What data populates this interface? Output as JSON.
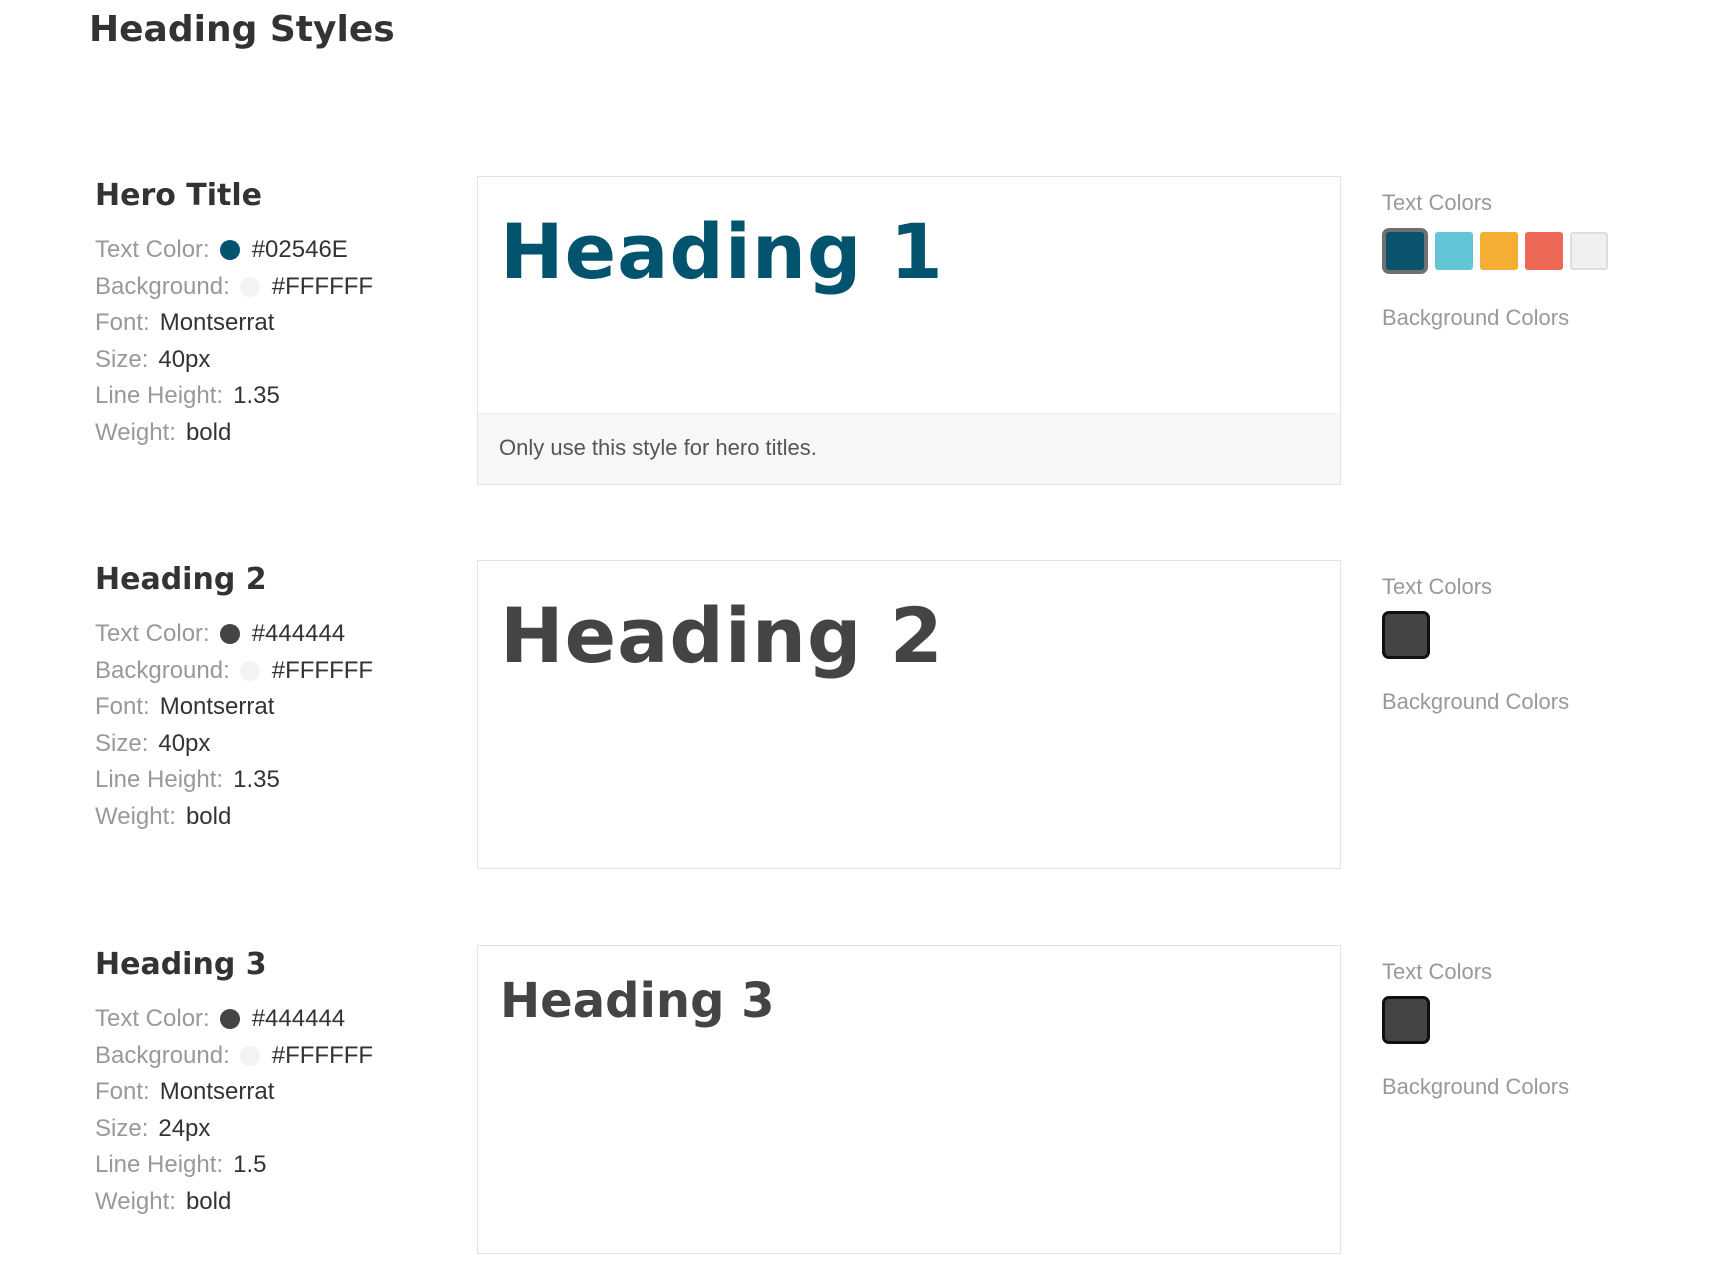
{
  "page": {
    "title": "Heading Styles"
  },
  "labels": {
    "text_color": "Text Color:",
    "background": "Background:",
    "font": "Font:",
    "size": "Size:",
    "line_height": "Line Height:",
    "weight": "Weight:",
    "text_colors": "Text Colors",
    "background_colors": "Background Colors"
  },
  "sections": [
    {
      "name": "Hero Title",
      "preview_text": "Heading 1",
      "note": "Only use this style for hero titles.",
      "text_color": "#02546E",
      "text_color_hex": "#02546E",
      "background": "#FFFFFF",
      "background_hex": "#FFFFFF",
      "font": "Montserrat",
      "size": "40px",
      "line_height": "1.35",
      "weight": "bold",
      "swatches": [
        {
          "name": "teal-swatch",
          "color": "#0B536D",
          "selected": true
        },
        {
          "name": "aqua-swatch",
          "color": "#62C6D6",
          "selected": false
        },
        {
          "name": "orange-swatch",
          "color": "#F4AE34",
          "selected": false
        },
        {
          "name": "coral-swatch",
          "color": "#EE6656",
          "selected": false
        },
        {
          "name": "light-gray-swatch",
          "color": "#F0F0F0",
          "selected": false,
          "light": true
        }
      ]
    },
    {
      "name": "Heading 2",
      "preview_text": "Heading 2",
      "note": "",
      "text_color": "#444444",
      "text_color_hex": "#444444",
      "background": "#FFFFFF",
      "background_hex": "#FFFFFF",
      "font": "Montserrat",
      "size": "40px",
      "line_height": "1.35",
      "weight": "bold",
      "swatches": [
        {
          "name": "dark-gray-swatch",
          "color": "#444444",
          "selected": true
        }
      ]
    },
    {
      "name": "Heading 3",
      "preview_text": "Heading 3",
      "note": "",
      "text_color": "#444444",
      "text_color_hex": "#444444",
      "background": "#FFFFFF",
      "background_hex": "#FFFFFF",
      "font": "Montserrat",
      "size": "24px",
      "line_height": "1.5",
      "weight": "bold",
      "swatches": [
        {
          "name": "dark-gray-swatch",
          "color": "#444444",
          "selected": true
        }
      ]
    }
  ]
}
